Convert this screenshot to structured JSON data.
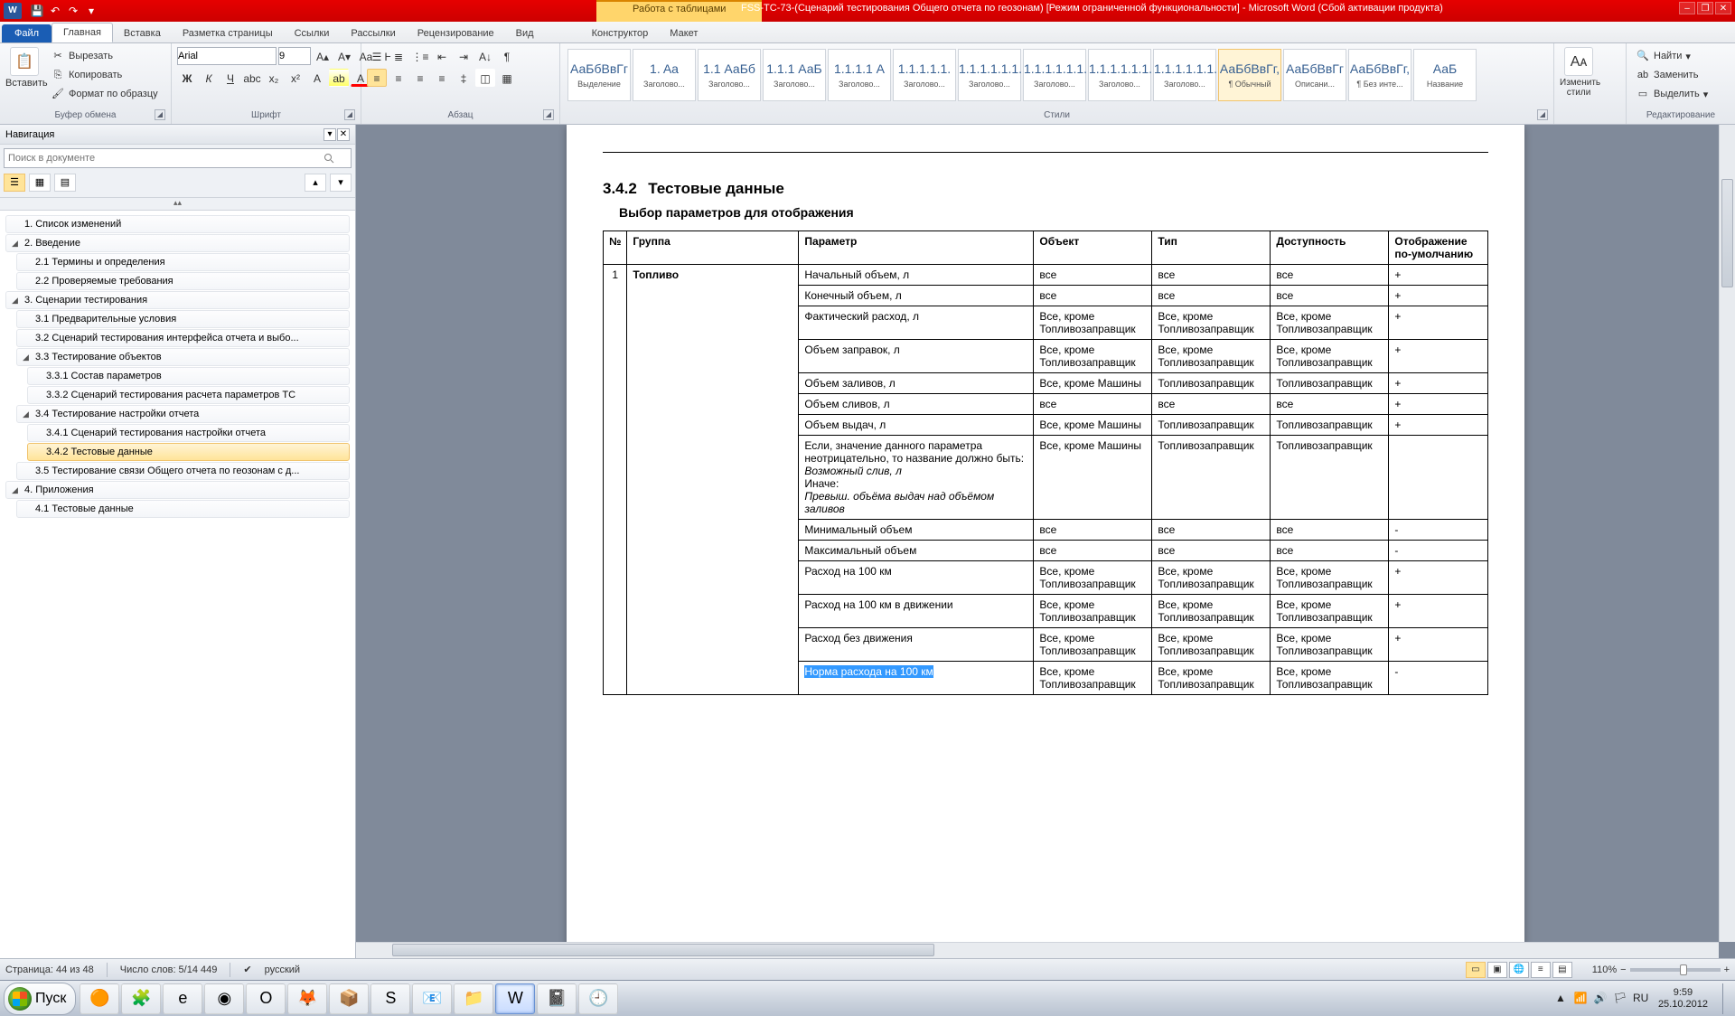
{
  "titlebar": {
    "context_label": "Работа с таблицами",
    "document_title": "FSS-TC-73-(Сценарий тестирования Общего отчета по геозонам) [Режим ограниченной функциональности] - Microsoft Word (Сбой активации продукта)"
  },
  "tabs": {
    "file": "Файл",
    "items": [
      "Главная",
      "Вставка",
      "Разметка страницы",
      "Ссылки",
      "Рассылки",
      "Рецензирование",
      "Вид"
    ],
    "context": [
      "Конструктор",
      "Макет"
    ]
  },
  "ribbon": {
    "clipboard": {
      "label": "Буфер обмена",
      "paste": "Вставить",
      "cut": "Вырезать",
      "copy": "Копировать",
      "format_painter": "Формат по образцу"
    },
    "font": {
      "label": "Шрифт",
      "name": "Arial",
      "size": "9"
    },
    "paragraph": {
      "label": "Абзац"
    },
    "styles": {
      "label": "Стили",
      "items": [
        {
          "prev": "АаБбВвГг",
          "name": "Выделение"
        },
        {
          "prev": "1. Aa",
          "name": "Заголово..."
        },
        {
          "prev": "1.1 АаБб",
          "name": "Заголово..."
        },
        {
          "prev": "1.1.1 АаБ",
          "name": "Заголово..."
        },
        {
          "prev": "1.1.1.1 А",
          "name": "Заголово..."
        },
        {
          "prev": "1.1.1.1.1.",
          "name": "Заголово..."
        },
        {
          "prev": "1.1.1.1.1.1.",
          "name": "Заголово..."
        },
        {
          "prev": "1.1.1.1.1.1.",
          "name": "Заголово..."
        },
        {
          "prev": "1.1.1.1.1.1.",
          "name": "Заголово..."
        },
        {
          "prev": "1.1.1.1.1.1.",
          "name": "Заголово..."
        },
        {
          "prev": "АаБбВвГг,",
          "name": "¶ Обычный"
        },
        {
          "prev": "АаБбВвГг",
          "name": "Описани..."
        },
        {
          "prev": "АаБбВвГг,",
          "name": "¶ Без инте..."
        },
        {
          "prev": "АаБ",
          "name": "Название"
        }
      ],
      "change_styles": "Изменить стили"
    },
    "editing": {
      "label": "Редактирование",
      "find": "Найти",
      "replace": "Заменить",
      "select": "Выделить"
    }
  },
  "nav": {
    "title": "Навигация",
    "search_placeholder": "Поиск в документе",
    "tree": [
      {
        "lvl": 1,
        "caret": "",
        "txt": "1. Список изменений"
      },
      {
        "lvl": 1,
        "caret": "◢",
        "txt": "2. Введение"
      },
      {
        "lvl": 2,
        "caret": "",
        "txt": "2.1 Термины и определения"
      },
      {
        "lvl": 2,
        "caret": "",
        "txt": "2.2 Проверяемые требования"
      },
      {
        "lvl": 1,
        "caret": "◢",
        "txt": "3. Сценарии тестирования"
      },
      {
        "lvl": 2,
        "caret": "",
        "txt": "3.1 Предварительные условия"
      },
      {
        "lvl": 2,
        "caret": "",
        "txt": "3.2 Сценарий тестирования  интерфейса отчета  и выбо..."
      },
      {
        "lvl": 2,
        "caret": "◢",
        "txt": "3.3 Тестирование объектов"
      },
      {
        "lvl": 3,
        "caret": "",
        "txt": "3.3.1 Состав параметров"
      },
      {
        "lvl": 3,
        "caret": "",
        "txt": "3.3.2 Сценарий тестирования расчета параметров ТС"
      },
      {
        "lvl": 2,
        "caret": "◢",
        "txt": "3.4 Тестирование настройки отчета"
      },
      {
        "lvl": 3,
        "caret": "",
        "txt": "3.4.1 Сценарий тестирования настройки  отчета"
      },
      {
        "lvl": 3,
        "caret": "",
        "txt": "3.4.2 Тестовые данные",
        "sel": true
      },
      {
        "lvl": 2,
        "caret": "",
        "txt": "3.5 Тестирование связи  Общего отчета по геозонам  с д..."
      },
      {
        "lvl": 1,
        "caret": "◢",
        "txt": "4. Приложения"
      },
      {
        "lvl": 2,
        "caret": "",
        "txt": "4.1 Тестовые данные"
      }
    ]
  },
  "doc": {
    "heading_num": "3.4.2",
    "heading_txt": "Тестовые данные",
    "subtitle": "Выбор параметров для отображения",
    "headers": [
      "№",
      "Группа",
      "Параметр",
      "Объект",
      "Тип",
      "Доступность",
      "Отображение по-умолчанию"
    ],
    "group_num": "1",
    "group_name": "Топливо",
    "rows": [
      {
        "param": "Начальный объем, л",
        "obj": "все",
        "typ": "все",
        "avail": "все",
        "def": "+"
      },
      {
        "param": "Конечный объем, л",
        "obj": "все",
        "typ": "все",
        "avail": "все",
        "def": "+"
      },
      {
        "param": "Фактический расход, л",
        "obj": "Все, кроме Топливозаправщик",
        "typ": "Все, кроме Топливозаправщик",
        "avail": "Все, кроме Топливозаправщик",
        "def": "+"
      },
      {
        "param": "Объем заправок, л",
        "obj": "Все, кроме Топливозаправщик",
        "typ": "Все, кроме Топливозаправщик",
        "avail": "Все, кроме Топливозаправщик",
        "def": "+"
      },
      {
        "param": "Объем заливов, л",
        "obj": "Все, кроме Машины",
        "typ": "Топливозаправщик",
        "avail": "Топливозаправщик",
        "def": "+"
      },
      {
        "param": "Объем сливов, л",
        "obj": "все",
        "typ": "все",
        "avail": "все",
        "def": "+"
      },
      {
        "param": "Объем выдач, л",
        "obj": "Все, кроме Машины",
        "typ": "Топливозаправщик",
        "avail": "Топливозаправщик",
        "def": "+"
      },
      {
        "param_html": "Если, значение данного параметра неотрицательно, то название должно быть:<br><span class='italic'>Возможный слив, л</span><br>Иначе:<br><span class='italic'>Превыш. объёма выдач над объёмом заливов</span>",
        "obj": "Все, кроме Машины",
        "typ": "Топливозаправщик",
        "avail": "Топливозаправщик",
        "def": ""
      },
      {
        "param": "Минимальный объем",
        "obj": "все",
        "typ": "все",
        "avail": "все",
        "def": "-"
      },
      {
        "param": "Максимальный объем",
        "obj": "все",
        "typ": "все",
        "avail": "все",
        "def": "-"
      },
      {
        "param": "Расход на 100 км",
        "obj": "Все, кроме Топливозаправщик",
        "typ": "Все, кроме Топливозаправщик",
        "avail": "Все, кроме Топливозаправщик",
        "def": "+"
      },
      {
        "param": "Расход на 100 км в движении",
        "obj": "Все, кроме Топливозаправщик",
        "typ": "Все, кроме Топливозаправщик",
        "avail": "Все, кроме Топливозаправщик",
        "def": "+"
      },
      {
        "param": "Расход без движения",
        "obj": "Все, кроме Топливозаправщик",
        "typ": "Все, кроме Топливозаправщик",
        "avail": "Все, кроме Топливозаправщик",
        "def": "+"
      },
      {
        "param_sel": "Норма расхода на 100 км",
        "obj": "Все, кроме Топливозаправщик",
        "typ": "Все, кроме Топливозаправщик",
        "avail": "Все, кроме Топливозаправщик",
        "def": "-"
      }
    ]
  },
  "status": {
    "page": "Страница: 44 из 48",
    "words": "Число слов: 5/14 449",
    "lang": "русский",
    "zoom": "110%"
  },
  "taskbar": {
    "start": "Пуск",
    "time": "9:59",
    "date": "25.10.2012"
  }
}
